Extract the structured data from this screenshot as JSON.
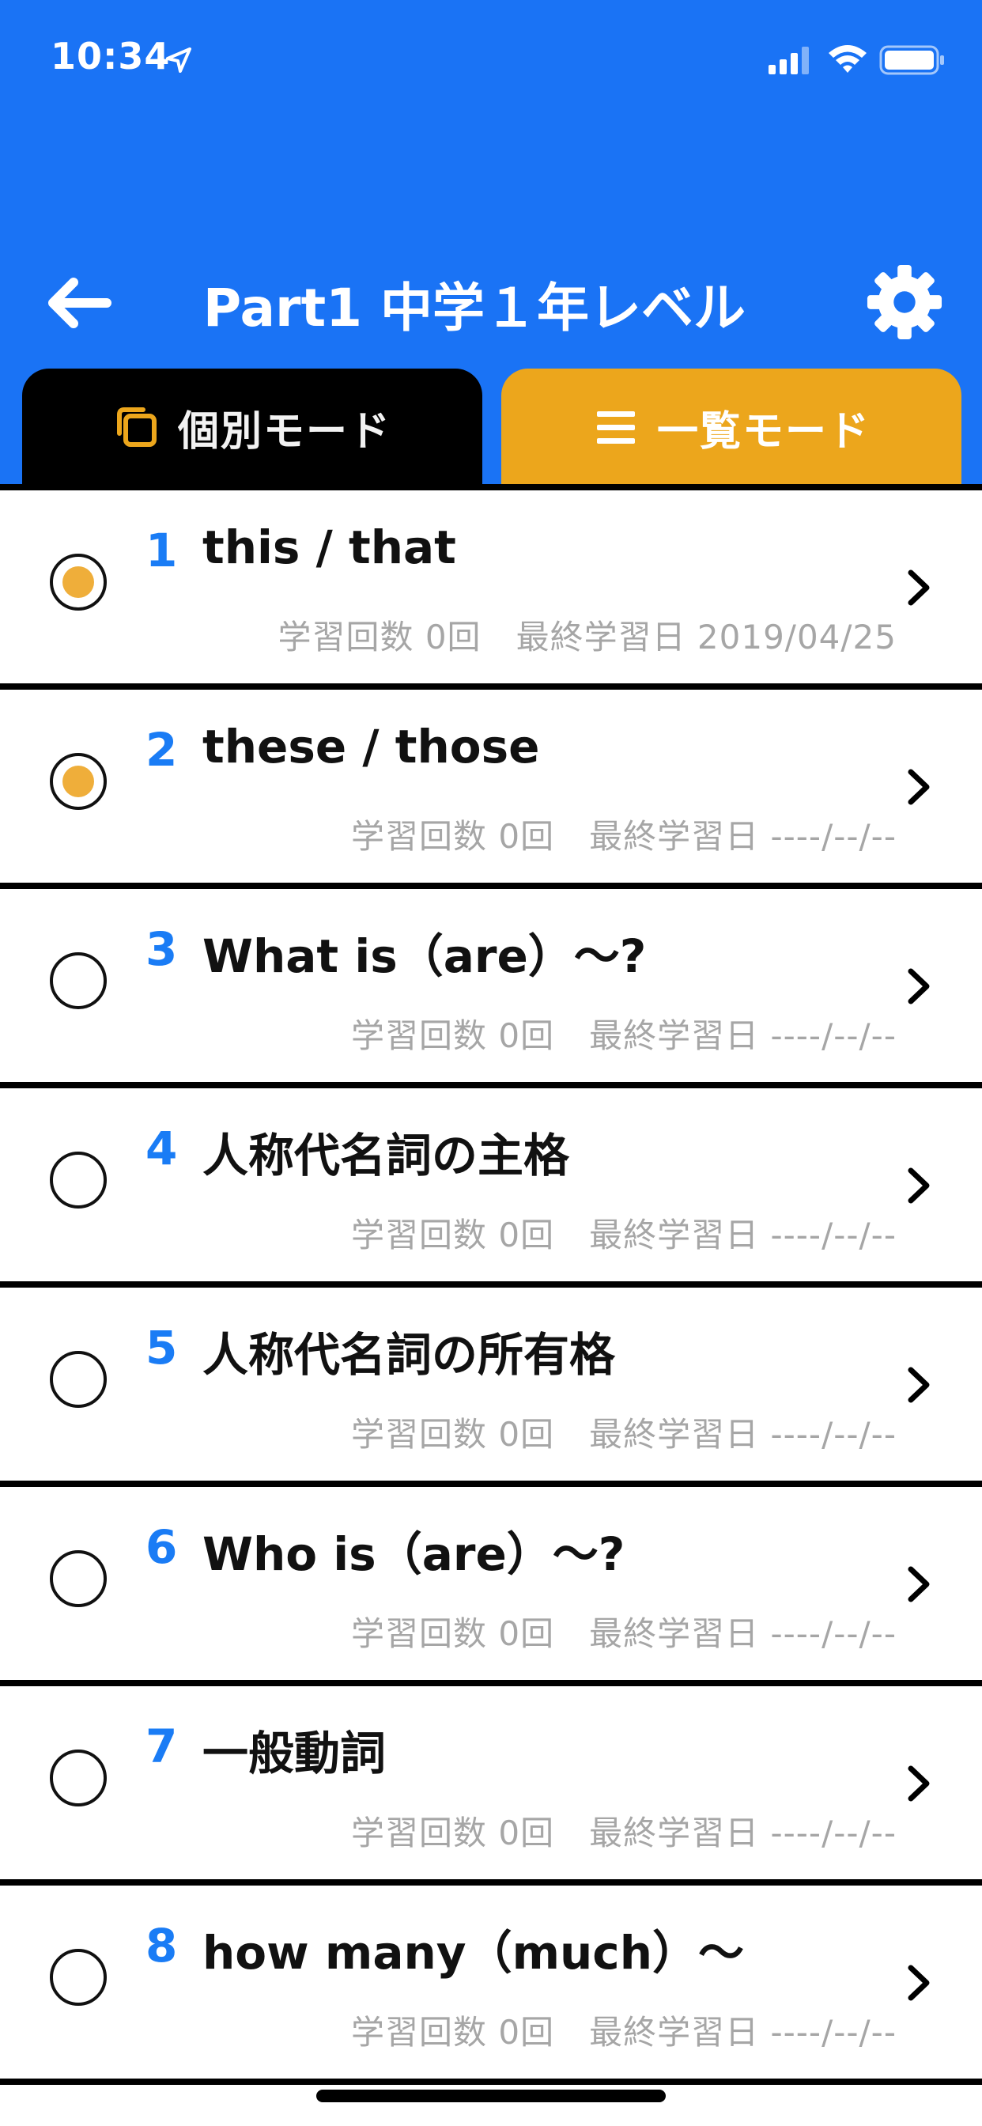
{
  "status_bar": {
    "time": "10:34"
  },
  "header": {
    "title": "Part1 中学１年レベル",
    "back_icon": "arrow-left-icon",
    "settings_icon": "gear-icon"
  },
  "tabs": [
    {
      "label": "個別モード",
      "icon": "copy-squares-icon",
      "color": "#000000"
    },
    {
      "label": "一覧モード",
      "icon": "list-lines-icon",
      "color": "#eca61c"
    }
  ],
  "colors": {
    "header_blue": "#1a73f5",
    "number_blue": "#1a7cf5",
    "accent_orange": "#efae3a",
    "meta_gray": "#a6a6a6"
  },
  "items": [
    {
      "num": "1",
      "title": "this / that",
      "count_label": "学習回数 0回",
      "date_label": "最終学習日 2019/04/25",
      "studied": true
    },
    {
      "num": "2",
      "title": "these / those",
      "count_label": "学習回数 0回",
      "date_label": "最終学習日 ----/--/--",
      "studied": true
    },
    {
      "num": "3",
      "title": "What is（are）〜?",
      "count_label": "学習回数 0回",
      "date_label": "最終学習日 ----/--/--",
      "studied": false
    },
    {
      "num": "4",
      "title": "人称代名詞の主格",
      "count_label": "学習回数 0回",
      "date_label": "最終学習日 ----/--/--",
      "studied": false
    },
    {
      "num": "5",
      "title": "人称代名詞の所有格",
      "count_label": "学習回数 0回",
      "date_label": "最終学習日 ----/--/--",
      "studied": false
    },
    {
      "num": "6",
      "title": "Who is（are）〜?",
      "count_label": "学習回数 0回",
      "date_label": "最終学習日 ----/--/--",
      "studied": false
    },
    {
      "num": "7",
      "title": "一般動詞",
      "count_label": "学習回数 0回",
      "date_label": "最終学習日 ----/--/--",
      "studied": false
    },
    {
      "num": "8",
      "title": "how many（much）〜",
      "count_label": "学習回数 0回",
      "date_label": "最終学習日 ----/--/--",
      "studied": false
    }
  ]
}
